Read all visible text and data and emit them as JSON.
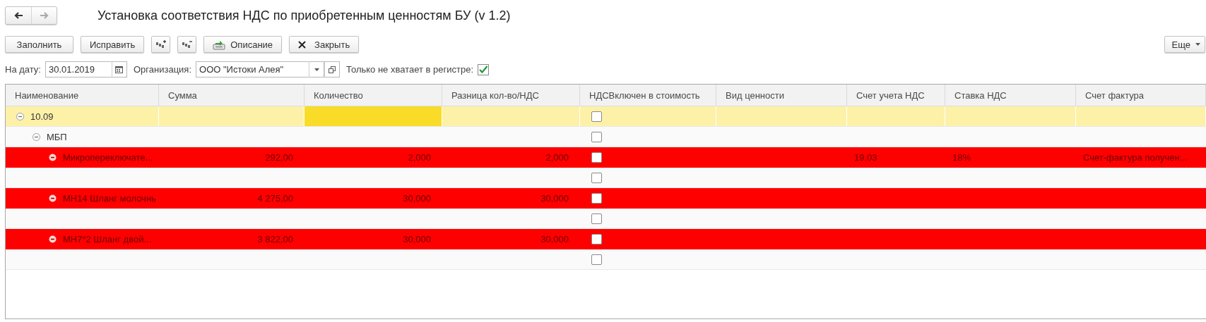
{
  "window": {
    "title": "Установка соответствия НДС по приобретенным ценностям БУ (v 1.2)"
  },
  "nav": [
    {
      "kind": "back",
      "disabled": false
    },
    {
      "kind": "forward",
      "disabled": true
    }
  ],
  "toolbar": {
    "buttons": [
      {
        "kind": "text",
        "label": "Заполнить"
      },
      {
        "kind": "text",
        "label": "Исправить"
      },
      {
        "kind": "expand"
      },
      {
        "kind": "collapse"
      },
      {
        "kind": "export",
        "label": "Описание"
      },
      {
        "kind": "close",
        "label": "Закрыть"
      }
    ],
    "more": {
      "label": "Еще"
    }
  },
  "filters": {
    "date": {
      "label": "На дату:",
      "value": "30.01.2019"
    },
    "organization": {
      "label": "Организация:",
      "value": "ООО \"Истоки Алея\""
    },
    "only_missing": {
      "label": "Только не хватает в регистре:",
      "checked": true
    }
  },
  "table": {
    "columns": [
      {
        "kind": "tree",
        "title": "Наименование"
      },
      {
        "kind": "number",
        "title": "Сумма"
      },
      {
        "kind": "number",
        "title": "Количество"
      },
      {
        "kind": "number",
        "title": "Разница кол-во/НДС"
      },
      {
        "kind": "checkbox",
        "title": "НДСВключен в стоимость"
      },
      {
        "kind": "text",
        "title": "Вид ценности"
      },
      {
        "kind": "text",
        "title": "Счет учета НДС"
      },
      {
        "kind": "text",
        "title": "Ставка НДС"
      },
      {
        "kind": "text",
        "title": "Счет фактура"
      }
    ],
    "rows": [
      {
        "kind": "group",
        "name": "10.09",
        "expanded": true,
        "selected": true,
        "checked": false,
        "cells": [
          {
            "focused": false
          },
          {
            "focused": true
          },
          {
            "focused": false
          },
          {
            "focused": false
          },
          {
            "focused": false
          },
          {
            "focused": false
          },
          {
            "focused": false
          }
        ],
        "children": [
          {
            "kind": "group",
            "name": "МБП",
            "expanded": true,
            "selected": false,
            "checked": false,
            "cells": [
              {
                "focused": false
              },
              {
                "focused": false
              },
              {
                "focused": false
              },
              {
                "focused": false
              },
              {
                "focused": false
              },
              {
                "focused": false
              },
              {
                "focused": false
              }
            ],
            "children": [
              {
                "kind": "error",
                "name": "Микропереключате...",
                "selected": false,
                "checked": false,
                "cells": [
                  {
                    "text": "292,00",
                    "focused": false
                  },
                  {
                    "text": "2,000",
                    "focused": false
                  },
                  {
                    "text": "2,000",
                    "focused": false
                  },
                  {
                    "focused": false
                  },
                  {
                    "text": "19.03",
                    "focused": false
                  },
                  {
                    "text": "18%",
                    "focused": false
                  },
                  {
                    "text": "Счет-фактура получен...",
                    "focused": false
                  }
                ]
              },
              {
                "kind": "blank",
                "selected": false,
                "checked": false,
                "cells": [
                  {
                    "focused": false
                  },
                  {
                    "focused": false
                  },
                  {
                    "focused": false
                  },
                  {
                    "focused": false
                  },
                  {
                    "focused": false
                  },
                  {
                    "focused": false
                  },
                  {
                    "focused": false
                  }
                ]
              },
              {
                "kind": "error",
                "name": "МН14 Шланг молочнь",
                "selected": false,
                "checked": false,
                "cells": [
                  {
                    "text": "4 275,00",
                    "focused": false
                  },
                  {
                    "text": "30,000",
                    "focused": false
                  },
                  {
                    "text": "30,000",
                    "focused": false
                  },
                  {
                    "focused": false
                  },
                  {
                    "focused": false
                  },
                  {
                    "focused": false
                  },
                  {
                    "focused": false
                  }
                ]
              },
              {
                "kind": "blank",
                "selected": false,
                "checked": false,
                "cells": [
                  {
                    "focused": false
                  },
                  {
                    "focused": false
                  },
                  {
                    "focused": false
                  },
                  {
                    "focused": false
                  },
                  {
                    "focused": false
                  },
                  {
                    "focused": false
                  },
                  {
                    "focused": false
                  }
                ]
              },
              {
                "kind": "error",
                "name": "МН7*2 Шланг двой...",
                "selected": false,
                "checked": false,
                "cells": [
                  {
                    "text": "3 822,00",
                    "focused": false
                  },
                  {
                    "text": "30,000",
                    "focused": false
                  },
                  {
                    "text": "30,000",
                    "focused": false
                  },
                  {
                    "focused": false
                  },
                  {
                    "focused": false
                  },
                  {
                    "focused": false
                  },
                  {
                    "focused": false
                  }
                ]
              },
              {
                "kind": "blank",
                "selected": false,
                "checked": false,
                "cells": [
                  {
                    "focused": false
                  },
                  {
                    "focused": false
                  },
                  {
                    "focused": false
                  },
                  {
                    "focused": false
                  },
                  {
                    "focused": false
                  },
                  {
                    "focused": false
                  },
                  {
                    "focused": false
                  }
                ]
              }
            ]
          }
        ]
      }
    ]
  }
}
